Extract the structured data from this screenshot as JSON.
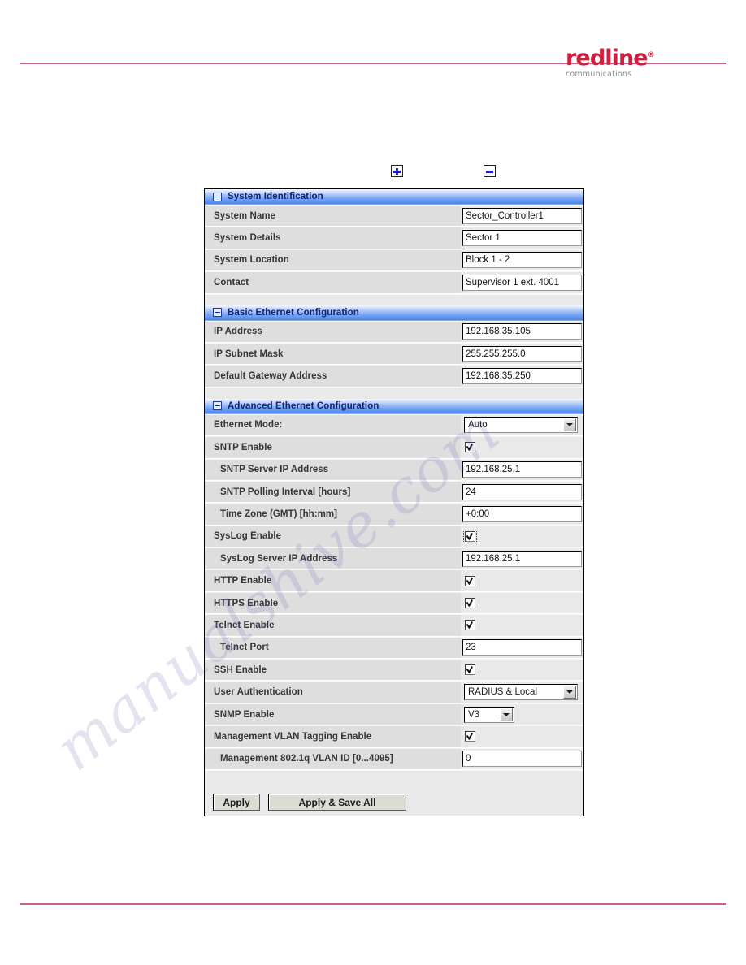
{
  "header": {
    "logo_word": "redline",
    "logo_tm": "®",
    "logo_sub": "communications",
    "rule_color": "#c9628a"
  },
  "legend": {
    "expand_icon": "plus-box-icon",
    "collapse_icon": "minus-box-icon"
  },
  "watermark": {
    "text": "manualshive.com"
  },
  "panel": {
    "sections": [
      {
        "title": "System Identification",
        "rows": [
          {
            "label": "System Name",
            "type": "text",
            "value": "Sector_Controller1",
            "indent": false
          },
          {
            "label": "System Details",
            "type": "text",
            "value": "Sector 1",
            "indent": false
          },
          {
            "label": "System Location",
            "type": "text",
            "value": "Block 1 - 2",
            "indent": false
          },
          {
            "label": "Contact",
            "type": "text",
            "value": "Supervisor 1 ext. 4001",
            "indent": false
          }
        ]
      },
      {
        "title": "Basic Ethernet Configuration",
        "rows": [
          {
            "label": "IP Address",
            "type": "text",
            "value": "192.168.35.105",
            "indent": false
          },
          {
            "label": "IP Subnet Mask",
            "type": "text",
            "value": "255.255.255.0",
            "indent": false
          },
          {
            "label": "Default Gateway Address",
            "type": "text",
            "value": "192.168.35.250",
            "indent": false
          }
        ]
      },
      {
        "title": "Advanced Ethernet Configuration",
        "rows": [
          {
            "label": "Ethernet Mode:",
            "type": "select-wide",
            "value": "Auto",
            "indent": false
          },
          {
            "label": "SNTP Enable",
            "type": "checkbox",
            "value": "checked",
            "indent": false
          },
          {
            "label": "SNTP Server IP Address",
            "type": "text",
            "value": "192.168.25.1",
            "indent": true
          },
          {
            "label": "SNTP Polling Interval [hours]",
            "type": "text",
            "value": "24",
            "indent": true
          },
          {
            "label": "Time Zone (GMT) [hh:mm]",
            "type": "text",
            "value": "+0:00",
            "indent": true
          },
          {
            "label": "SysLog Enable",
            "type": "checkbox-focused",
            "value": "checked",
            "indent": false
          },
          {
            "label": "SysLog Server IP Address",
            "type": "text",
            "value": "192.168.25.1",
            "indent": true
          },
          {
            "label": "HTTP Enable",
            "type": "checkbox",
            "value": "checked",
            "indent": false
          },
          {
            "label": "HTTPS Enable",
            "type": "checkbox",
            "value": "checked",
            "indent": false
          },
          {
            "label": "Telnet Enable",
            "type": "checkbox",
            "value": "checked",
            "indent": false
          },
          {
            "label": "Telnet Port",
            "type": "text",
            "value": "23",
            "indent": true
          },
          {
            "label": "SSH Enable",
            "type": "checkbox",
            "value": "checked",
            "indent": false
          },
          {
            "label": "User Authentication",
            "type": "select-wide",
            "value": "RADIUS & Local",
            "indent": false
          },
          {
            "label": "SNMP Enable",
            "type": "select-narrow",
            "value": "V3",
            "indent": false
          },
          {
            "label": "Management VLAN Tagging Enable",
            "type": "checkbox",
            "value": "checked",
            "indent": false
          },
          {
            "label": "Management 802.1q VLAN ID [0...4095]",
            "type": "text",
            "value": "0",
            "indent": true
          }
        ]
      }
    ],
    "buttons": {
      "apply": "Apply",
      "apply_save_all": "Apply & Save All"
    }
  }
}
